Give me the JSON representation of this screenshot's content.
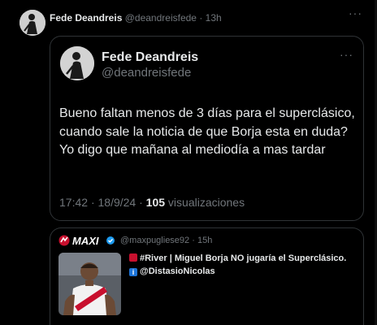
{
  "outer_tweet": {
    "display_name": "Fede Deandreis",
    "handle": "@deandreisfede",
    "separator": "·",
    "time": "13h",
    "more_label": "···"
  },
  "quoted_tweet": {
    "display_name": "Fede Deandreis",
    "handle": "@deandreisfede",
    "more_label": "···",
    "text": "Bueno faltan menos de 3 días para el superclásico, cuando sale la noticia de que Borja esta en duda? Yo digo que mañana al mediodía a mas tardar",
    "time": "17:42",
    "date": "18/9/24",
    "views_count": "105",
    "views_label": "visualizaciones",
    "sep": "·"
  },
  "embedded_tweet": {
    "logo_text": "MAXI",
    "handle": "@maxpugliese92",
    "sep": "·",
    "time": "15h",
    "line1": "#River | Miguel Borja NO jugaría el Superclásico.",
    "line2": "@DistasioNicolas",
    "emoji1": "river-emoji",
    "emoji2": "info-emoji"
  },
  "colors": {
    "background": "#000000",
    "text_primary": "#e7e9ea",
    "text_secondary": "#71767b",
    "border": "#2f3336",
    "river_red": "#c8102e"
  }
}
